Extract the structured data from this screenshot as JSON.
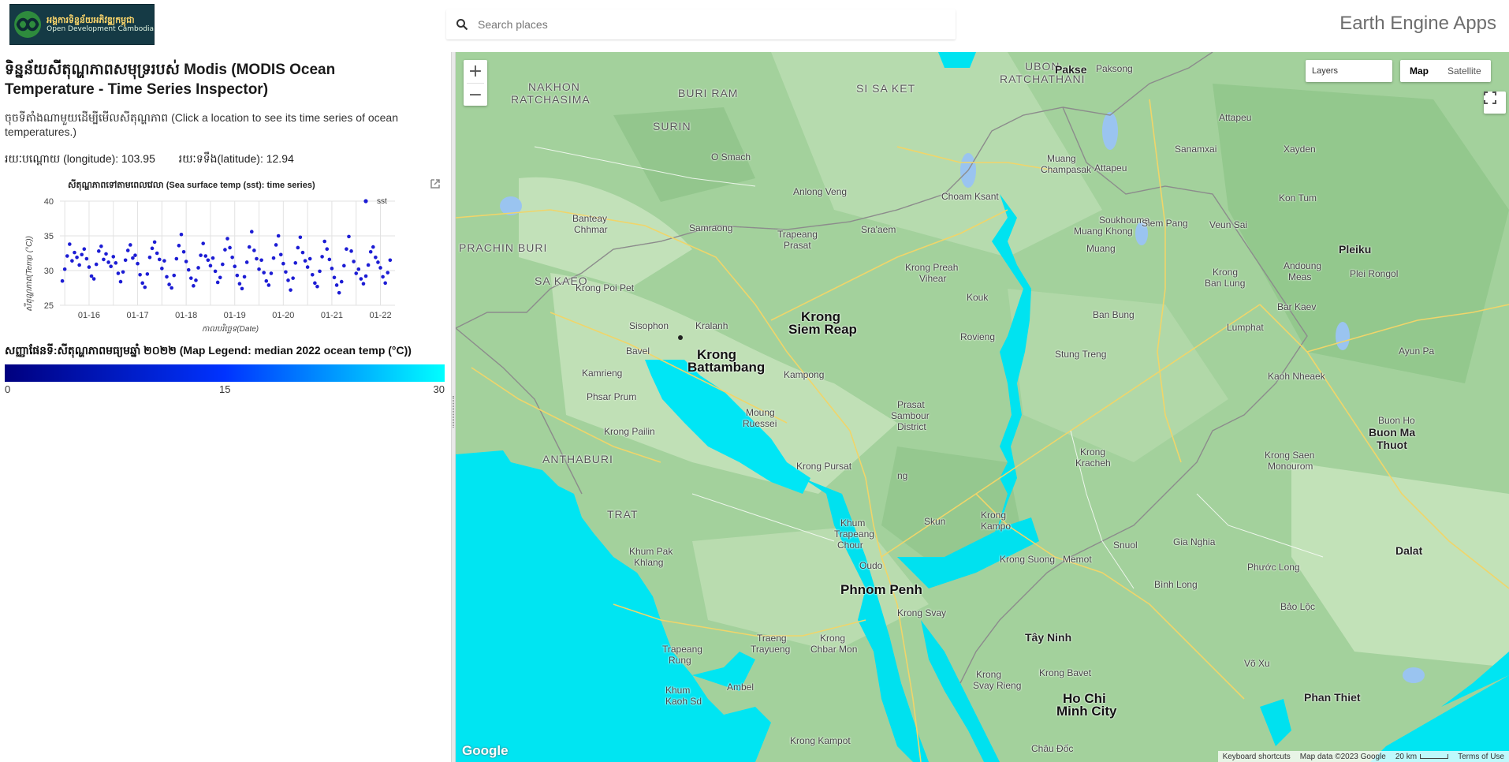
{
  "header": {
    "logo_kh": "អង្គការទិន្នន័យអភិវឌ្ឍកម្ពុជា",
    "logo_en": "Open Development Cambodia",
    "search_placeholder": "Search places",
    "app_title": "Earth Engine Apps"
  },
  "panel": {
    "title": "ទិន្នន័យសីតុណ្ហភាពសមុទ្ររបស់ Modis (MODIS Ocean Temperature - Time Series Inspector)",
    "description": "ចុចទីតាំងណាមួយដើម្បីមើលសីតុណ្ហភាព (Click a location to see its time series of ocean temperatures.)",
    "longitude_label": "រយៈបណ្តោយ (longitude): 103.95",
    "latitude_label": "រយៈទទឹង(latitude): 12.94",
    "legend_title": "សញ្ញាផែនទី:សីតុណ្ហភាពមធ្យមឆ្នាំ ២០២២ (Map Legend: median 2022 ocean temp (°C))",
    "legend_min": "0",
    "legend_mid": "15",
    "legend_max": "30"
  },
  "chart_data": {
    "type": "scatter",
    "title": "សីតុណ្ហភាពទៅតាមពេលវេលា (Sea surface temp (sst): time series)",
    "xlabel": "កាលបរិច្ឆេទ(Date)",
    "ylabel": "សីតុណ្ហភាព(Temp (°C))",
    "legend": "sst",
    "legend_position": "top-right",
    "grid": true,
    "xlim": [
      2015.4,
      2022.3
    ],
    "ylim": [
      25,
      40
    ],
    "x_tick_labels": [
      "01-16",
      "01-17",
      "01-18",
      "01-19",
      "01-20",
      "01-21",
      "01-22"
    ],
    "y_ticks": [
      25,
      30,
      35,
      40
    ],
    "series_color": "#1c1cd4",
    "series": [
      {
        "name": "sst",
        "x": [
          2015.45,
          2015.5,
          2015.55,
          2015.6,
          2015.65,
          2015.7,
          2015.75,
          2015.8,
          2015.85,
          2015.9,
          2015.95,
          2016.0,
          2016.05,
          2016.1,
          2016.15,
          2016.2,
          2016.25,
          2016.3,
          2016.35,
          2016.4,
          2016.45,
          2016.5,
          2016.55,
          2016.6,
          2016.65,
          2016.7,
          2016.75,
          2016.8,
          2016.85,
          2016.9,
          2016.95,
          2017.0,
          2017.05,
          2017.1,
          2017.15,
          2017.2,
          2017.25,
          2017.3,
          2017.35,
          2017.4,
          2017.45,
          2017.5,
          2017.55,
          2017.6,
          2017.65,
          2017.7,
          2017.75,
          2017.8,
          2017.85,
          2017.9,
          2017.95,
          2018.0,
          2018.05,
          2018.1,
          2018.15,
          2018.2,
          2018.25,
          2018.3,
          2018.35,
          2018.4,
          2018.45,
          2018.5,
          2018.55,
          2018.6,
          2018.65,
          2018.7,
          2018.75,
          2018.8,
          2018.85,
          2018.9,
          2018.95,
          2019.0,
          2019.05,
          2019.1,
          2019.15,
          2019.2,
          2019.25,
          2019.3,
          2019.35,
          2019.4,
          2019.45,
          2019.5,
          2019.55,
          2019.6,
          2019.65,
          2019.7,
          2019.75,
          2019.8,
          2019.85,
          2019.9,
          2019.95,
          2020.0,
          2020.05,
          2020.1,
          2020.15,
          2020.2,
          2020.25,
          2020.3,
          2020.35,
          2020.4,
          2020.45,
          2020.5,
          2020.55,
          2020.6,
          2020.65,
          2020.7,
          2020.75,
          2020.8,
          2020.85,
          2020.9,
          2020.95,
          2021.0,
          2021.05,
          2021.1,
          2021.15,
          2021.2,
          2021.25,
          2021.3,
          2021.35,
          2021.4,
          2021.45,
          2021.5,
          2021.55,
          2021.6,
          2021.65,
          2021.7,
          2021.75,
          2021.8,
          2021.85,
          2021.9,
          2021.95,
          2022.0,
          2022.05,
          2022.1,
          2022.15,
          2022.2
        ],
        "y": [
          28.5,
          30.2,
          32.1,
          33.8,
          31.4,
          32.6,
          31.9,
          30.8,
          32.3,
          33.1,
          31.7,
          30.5,
          29.2,
          28.8,
          30.9,
          32.8,
          33.5,
          31.6,
          32.4,
          31.2,
          30.6,
          32.0,
          31.1,
          29.6,
          28.4,
          29.8,
          31.5,
          32.9,
          33.7,
          31.8,
          32.2,
          31.0,
          29.4,
          28.2,
          27.6,
          29.5,
          31.9,
          33.2,
          34.1,
          32.5,
          31.6,
          30.3,
          31.4,
          29.1,
          28.0,
          27.5,
          29.3,
          31.7,
          33.6,
          35.2,
          32.7,
          31.3,
          30.1,
          28.9,
          27.8,
          28.6,
          30.4,
          32.2,
          33.9,
          32.1,
          31.5,
          30.7,
          31.8,
          29.9,
          28.3,
          29.0,
          30.9,
          33.0,
          34.6,
          33.3,
          31.9,
          30.6,
          29.3,
          28.1,
          27.4,
          29.1,
          31.2,
          33.4,
          35.6,
          32.9,
          31.7,
          30.2,
          31.5,
          29.7,
          28.5,
          27.9,
          29.6,
          31.8,
          33.7,
          35.0,
          32.3,
          31.0,
          29.8,
          28.6,
          27.2,
          28.9,
          31.1,
          33.3,
          34.8,
          32.6,
          31.4,
          30.5,
          31.7,
          29.4,
          28.2,
          27.7,
          29.9,
          32.0,
          34.2,
          33.1,
          31.6,
          30.3,
          29.0,
          27.9,
          26.8,
          28.4,
          30.7,
          33.1,
          34.9,
          32.8,
          31.3,
          29.6,
          30.2,
          28.8,
          28.1,
          29.2,
          30.8,
          32.7,
          33.4,
          31.9,
          31.2,
          30.4,
          29.1,
          28.2,
          29.7,
          31.5
        ]
      }
    ]
  }
}
